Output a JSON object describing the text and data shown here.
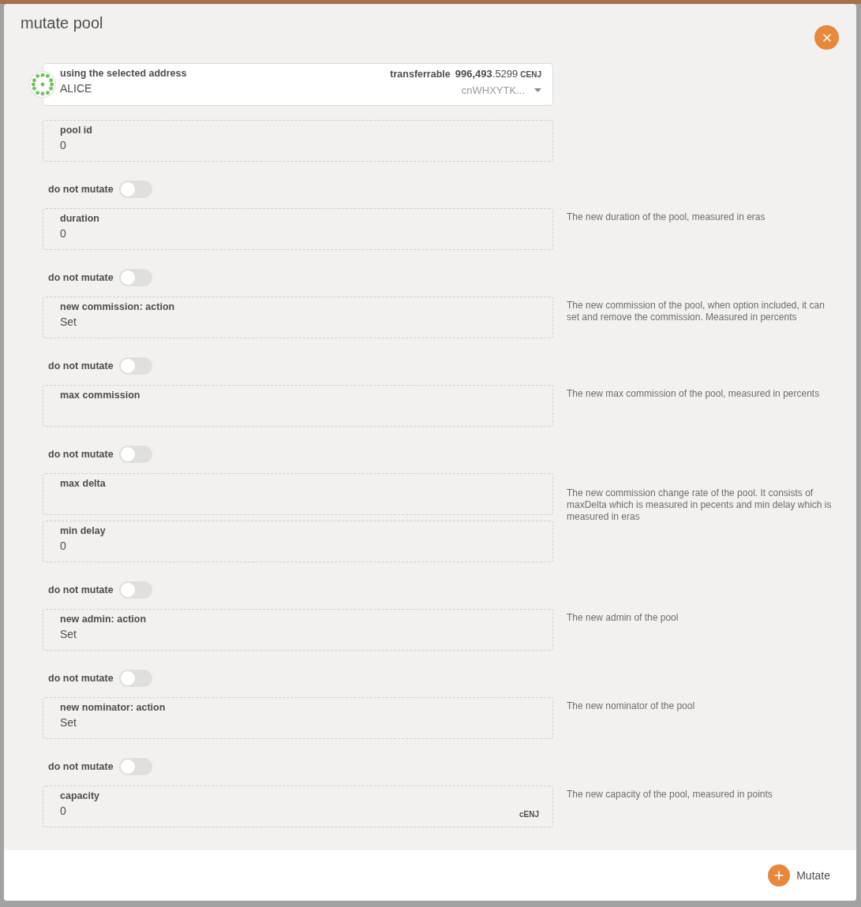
{
  "modal": {
    "title": "mutate pool",
    "account": {
      "label": "using the selected address",
      "name": "ALICE",
      "balance_label": "transferrable",
      "balance": "**996,493**.5299",
      "unit": "CENJ",
      "address": "cnWHXYTK..."
    },
    "sections": [
      {
        "fields": [
          {
            "label": "pool id",
            "value": "0"
          }
        ]
      },
      {
        "toggle": {
          "label": "do not mutate",
          "on": false
        },
        "fields": [
          {
            "label": "duration",
            "value": "0"
          }
        ],
        "help": "The new duration of the pool, measured in eras"
      },
      {
        "toggle": {
          "label": "do not mutate",
          "on": false
        },
        "fields": [
          {
            "label": "new commission: action",
            "value": "Set"
          }
        ],
        "help": "The new commission of the pool, when option included, it can set and remove the commission. Measured in percents"
      },
      {
        "toggle": {
          "label": "do not mutate",
          "on": false
        },
        "fields": [
          {
            "label": "max commission"
          }
        ],
        "help": "The new max commission of the pool, measured in percents"
      },
      {
        "toggle": {
          "label": "do not mutate",
          "on": false
        },
        "fields": [
          {
            "label": "max delta"
          },
          {
            "label": "min delay",
            "value": "0"
          }
        ],
        "help": "The new commission change rate of the pool. It consists of maxDelta which is measured in pecents and min delay which is measured in eras"
      },
      {
        "toggle": {
          "label": "do not mutate",
          "on": false
        },
        "fields": [
          {
            "label": "new admin: action",
            "value": "Set"
          }
        ],
        "help": "The new admin of the pool"
      },
      {
        "toggle": {
          "label": "do not mutate",
          "on": false
        },
        "fields": [
          {
            "label": "new nominator: action",
            "value": "Set"
          }
        ],
        "help": "The new nominator of the pool"
      },
      {
        "toggle": {
          "label": "do not mutate",
          "on": false
        },
        "fields": [
          {
            "label": "capacity",
            "value": "0",
            "unit": "cENJ"
          }
        ],
        "help": "The new capacity of the pool, measured in points"
      }
    ],
    "submit": {
      "label": "Mutate"
    }
  }
}
